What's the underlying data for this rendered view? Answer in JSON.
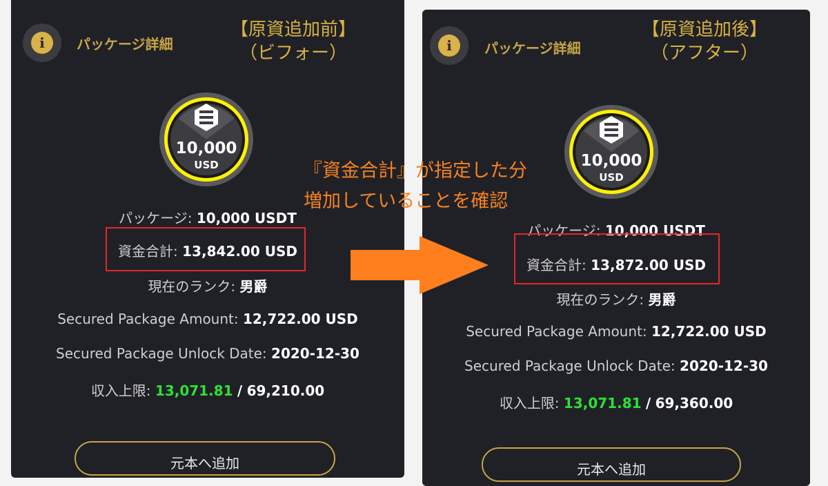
{
  "colors": {
    "panel_bg": "#202127",
    "gold": "#c9a545",
    "orange_note": "#f58220",
    "arrow": "#ff7f1e",
    "highlight_box": "#e4262b",
    "green_value": "#2fe035"
  },
  "icons": {
    "info": "info-circle-icon",
    "coin_logo": "hexagon-logo-icon",
    "arrow": "right-arrow-icon"
  },
  "center_note": {
    "line1": "『資金合計』が指定した分",
    "line2": "増加していることを確認"
  },
  "before": {
    "header_title": "パッケージ詳細",
    "annotation_line1": "【原資追加前】",
    "annotation_line2": "（ビフォー）",
    "coin": {
      "amount": "10,000",
      "unit": "USD"
    },
    "package": {
      "label": "パッケージ:",
      "value": "10,000 USDT"
    },
    "fund_total": {
      "label": "資金合計:",
      "value": "13,842.00 USD"
    },
    "rank": {
      "label": "現在のランク:",
      "value": "男爵"
    },
    "secured_amount": {
      "label": "Secured Package Amount:",
      "value": "12,722.00 USD"
    },
    "unlock_date": {
      "label": "Secured Package Unlock Date:",
      "value": "2020-12-30"
    },
    "income_limit": {
      "label": "収入上限:",
      "current": "13,071.81",
      "sep": "/",
      "max": "69,210.00"
    },
    "add_button": "元本へ追加"
  },
  "after": {
    "header_title": "パッケージ詳細",
    "annotation_line1": "【原資追加後】",
    "annotation_line2": "（アフター）",
    "coin": {
      "amount": "10,000",
      "unit": "USD"
    },
    "package": {
      "label": "パッケージ:",
      "value": "10,000 USDT"
    },
    "fund_total": {
      "label": "資金合計:",
      "value": "13,872.00 USD"
    },
    "rank": {
      "label": "現在のランク:",
      "value": "男爵"
    },
    "secured_amount": {
      "label": "Secured Package Amount:",
      "value": "12,722.00 USD"
    },
    "unlock_date": {
      "label": "Secured Package Unlock Date:",
      "value": "2020-12-30"
    },
    "income_limit": {
      "label": "収入上限:",
      "current": "13,071.81",
      "sep": "/",
      "max": "69,360.00"
    },
    "add_button": "元本へ追加"
  }
}
